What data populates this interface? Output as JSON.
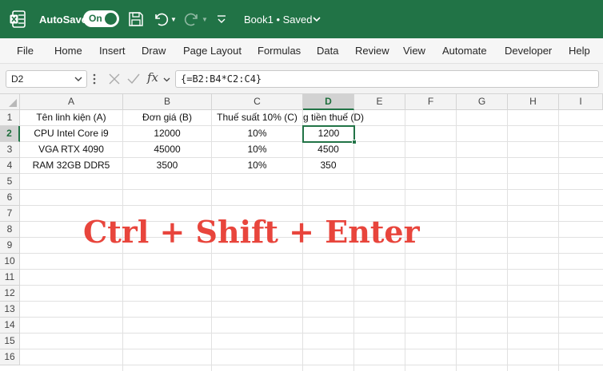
{
  "titlebar": {
    "autosave_label": "AutoSave",
    "autosave_state": "On",
    "document_title": "Book1 • Saved",
    "accent_color": "#217346"
  },
  "ribbon": {
    "tabs": [
      "File",
      "Home",
      "Insert",
      "Draw",
      "Page Layout",
      "Formulas",
      "Data",
      "Review",
      "View",
      "Automate",
      "Developer",
      "Help"
    ]
  },
  "formula_bar": {
    "name_box": "D2",
    "formula": "{=B2:B4*C2:C4}",
    "fx_label": "fx"
  },
  "sheet": {
    "columns": [
      "A",
      "B",
      "C",
      "D",
      "E",
      "F",
      "G",
      "H",
      "I"
    ],
    "rows": [
      "1",
      "2",
      "3",
      "4",
      "5",
      "6",
      "7",
      "8",
      "9",
      "10",
      "11",
      "12",
      "13",
      "14",
      "15",
      "16"
    ],
    "selected_column": "D",
    "selected_row": "2",
    "cells": {
      "header": [
        "Tên linh kiện (A)",
        "Đơn giá (B)",
        "Thuế suất 10% (C)",
        "g tiền thuế (D)"
      ],
      "data": [
        [
          "CPU Intel Core i9",
          "12000",
          "10%",
          "1200"
        ],
        [
          "VGA RTX 4090",
          "45000",
          "10%",
          "4500"
        ],
        [
          "RAM 32GB DDR5",
          "3500",
          "10%",
          "350"
        ]
      ]
    }
  },
  "overlay": {
    "text": "Ctrl + Shift + Enter",
    "color": "#e8453c"
  }
}
